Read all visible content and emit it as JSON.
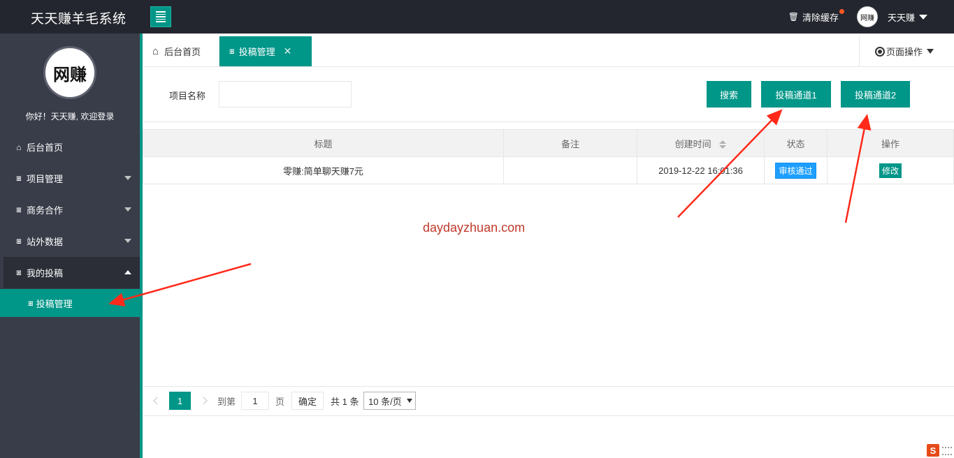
{
  "app": {
    "title": "天天赚羊毛系统"
  },
  "topbar": {
    "clear_cache": "清除缓存",
    "user_name": "天天赚",
    "avatar_text": "网赚"
  },
  "sidebar": {
    "avatar_text": "网赚",
    "welcome": "你好！天天赚, 欢迎登录",
    "items": [
      {
        "label": "后台首页",
        "icon": "home-icon"
      },
      {
        "label": "项目管理",
        "icon": "grid-icon"
      },
      {
        "label": "商务合作",
        "icon": "grid-icon"
      },
      {
        "label": "站外数据",
        "icon": "grid-icon"
      },
      {
        "label": "我的投稿",
        "icon": "grid-icon"
      }
    ],
    "sub_item": {
      "label": "投稿管理",
      "icon": "grid-icon"
    }
  },
  "tabs": {
    "home": "后台首页",
    "active": "投稿管理",
    "page_ops": "页面操作"
  },
  "filter": {
    "label": "项目名称",
    "input_value": "",
    "search_btn": "搜索",
    "channel1_btn": "投稿通道1",
    "channel2_btn": "投稿通道2"
  },
  "table": {
    "headers": [
      "标题",
      "备注",
      "创建时间",
      "状态",
      "操作"
    ],
    "rows": [
      {
        "title": "零赚:简单聊天赚7元",
        "remark": "",
        "created": "2019-12-22 16:01:36",
        "status": "审核通过",
        "action": "修改"
      }
    ]
  },
  "watermark": "daydayzhuan.com",
  "pagination": {
    "current_page": "1",
    "goto_label": "到第",
    "goto_value": "1",
    "page_label": "页",
    "confirm": "确定",
    "total": "共 1 条",
    "per_page": "10 条/页"
  },
  "colors": {
    "accent": "#009688",
    "topbar": "#23262e",
    "sidebar": "#393d49",
    "status_blue": "#1e9fff",
    "arrow_red": "#ff2a1a"
  }
}
